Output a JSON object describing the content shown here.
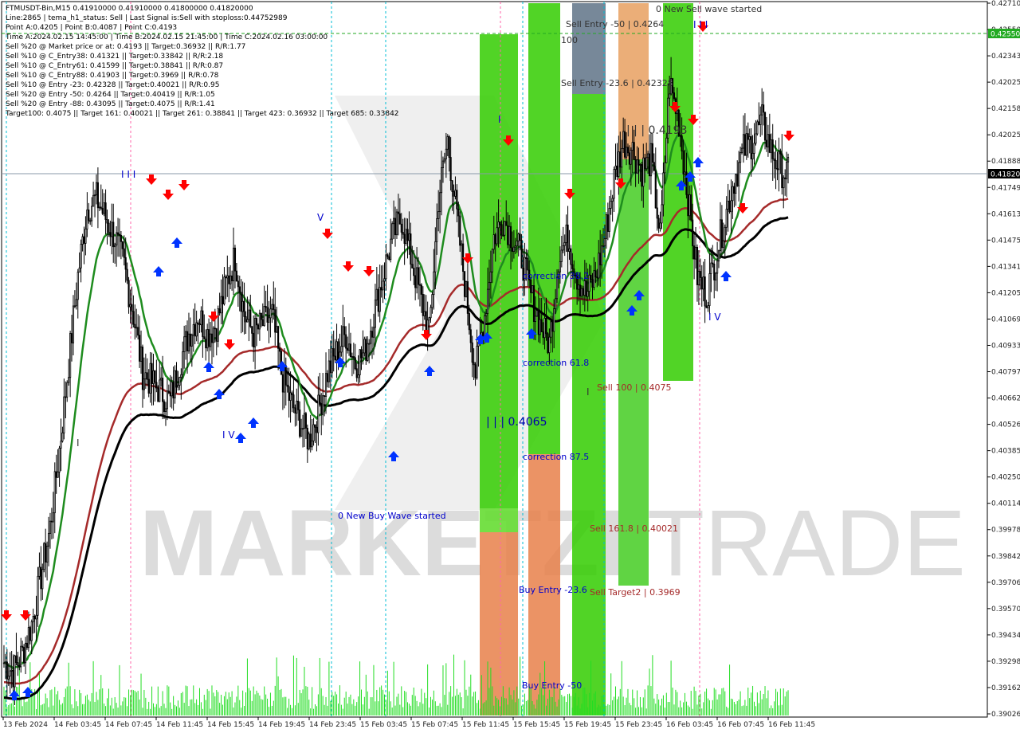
{
  "info": {
    "lines": [
      "FTMUSDT-Bin,M15  0.41910000 0.41910000 0.41800000 0.41820000",
      "Line:2865 | tema_h1_status: Sell | Last Signal is:Sell with stoploss:0.44752989",
      "Point A:0.4205 | Point B:0.4087 | Point C:0.4193",
      "Time A:2024.02.15 14:45:00 | Time B:2024.02.15 21:45:00 | Time C:2024.02.16 03:00:00",
      "Sell %20 @ Market price or at: 0.4193 || Target:0.36932 || R/R:1.77",
      "Sell %10 @ C_Entry38: 0.41321 || Target:0.33842 || R/R:2.18",
      "Sell %10 @ C_Entry61: 0.41599 || Target:0.38841 || R/R:0.87",
      "Sell %10 @ C_Entry88: 0.41903 || Target:0.3969 || R/R:0.78",
      "Sell %10 @ Entry -23: 0.42328 || Target:0.40021 || R/R:0.95",
      "Sell %20 @ Entry -50: 0.4264 || Target:0.40419 || R/R:1.05",
      "Sell %20 @ Entry -88: 0.43095 || Target:0.4075 || R/R:1.41",
      "Target100: 0.4075 || Target 161: 0.40021 || Target 261: 0.38841 || Target 423: 0.36932 || Target 685: 0.33842"
    ]
  },
  "watermark": {
    "left": "MARKETZI",
    "right": "TRADE"
  },
  "colors": {
    "bull": "#000000",
    "bear": "#000000",
    "ema_fast": "#1e8c1e",
    "ema_slow_black": "#000000",
    "ema_slow_red": "#a52a2a",
    "zone_green": "#33cc00",
    "zone_orange": "#e8804a",
    "zone_gray": "#778899",
    "arrow_up": "#0033ff",
    "arrow_down": "#ff0000",
    "volume": "#22dd22",
    "current_price_bg": "#000000",
    "level_green_bg": "#22aa22"
  },
  "annotations": {
    "sell_entry_50": "Sell Entry -50 | 0.4264",
    "sell_entry_23": "Sell Entry -23.6 | 0.42328",
    "new_sell_wave": "0 New Sell wave started",
    "new_buy_wave": "0 New Buy Wave started",
    "wave_4193": "| | | 0.4193",
    "wave_4065": "| | | 0.4065",
    "correction_382": "correction 38.2",
    "correction_618": "correction 61.8",
    "correction_875": "correction 87.5",
    "sell_100": "Sell 100 | 0.4075",
    "sell_1618": "Sell 161.8 | 0.40021",
    "sell_target2": "Sell Target2 | 0.3969",
    "buy_entry_236": "Buy Entry -23.6",
    "buy_entry_50": "Buy Entry -50",
    "label_100": "100",
    "wave_iii_a": "I I I",
    "wave_v_a": "V",
    "wave_iv_a": "I V",
    "wave_i_a": "I",
    "wave_iv_b": "I V",
    "wave_i_b": "I",
    "wave_iii_b": "I I I",
    "wave_v_b": "V"
  },
  "chart_data": {
    "type": "candlestick",
    "symbol": "FTMUSDT-Bin",
    "timeframe": "M15",
    "ylim": [
      0.39026,
      0.4271
    ],
    "current_price": "0.41820",
    "level_price": "0.42550",
    "y_ticks": [
      "0.42710",
      "0.42550",
      "0.42343",
      "0.42025",
      "0.42158",
      "0.42025",
      "0.41888",
      "0.41749",
      "0.41613",
      "0.41475",
      "0.41341",
      "0.41205",
      "0.41069",
      "0.40933",
      "0.40797",
      "0.40662",
      "0.40526",
      "0.40385",
      "0.40250",
      "0.40114",
      "0.39978",
      "0.39842",
      "0.39706",
      "0.39570",
      "0.39434",
      "0.39298",
      "0.39162",
      "0.39026"
    ],
    "x_ticks": [
      "13 Feb 2024",
      "14 Feb 03:45",
      "14 Feb 07:45",
      "14 Feb 11:45",
      "14 Feb 15:45",
      "14 Feb 19:45",
      "14 Feb 23:45",
      "15 Feb 03:45",
      "15 Feb 07:45",
      "15 Feb 11:45",
      "15 Feb 15:45",
      "15 Feb 19:45",
      "15 Feb 23:45",
      "16 Feb 03:45",
      "16 Feb 07:45",
      "16 Feb 11:45"
    ],
    "price_path": [
      0.393,
      0.3925,
      0.3935,
      0.395,
      0.3975,
      0.4,
      0.404,
      0.4085,
      0.413,
      0.4165,
      0.417,
      0.416,
      0.415,
      0.4135,
      0.411,
      0.408,
      0.4075,
      0.407,
      0.4065,
      0.4085,
      0.41,
      0.411,
      0.41,
      0.4105,
      0.4125,
      0.414,
      0.411,
      0.41,
      0.4105,
      0.411,
      0.408,
      0.4065,
      0.4055,
      0.4045,
      0.406,
      0.408,
      0.409,
      0.41,
      0.4085,
      0.409,
      0.411,
      0.413,
      0.415,
      0.416,
      0.414,
      0.412,
      0.41,
      0.417,
      0.42,
      0.416,
      0.412,
      0.408,
      0.411,
      0.415,
      0.416,
      0.415,
      0.414,
      0.412,
      0.4105,
      0.4095,
      0.414,
      0.415,
      0.413,
      0.412,
      0.413,
      0.415,
      0.418,
      0.42,
      0.4195,
      0.4185,
      0.419,
      0.415,
      0.423,
      0.421,
      0.417,
      0.413,
      0.412,
      0.414,
      0.416,
      0.418,
      0.4195,
      0.42,
      0.421,
      0.4195,
      0.4185,
      0.4182
    ]
  }
}
